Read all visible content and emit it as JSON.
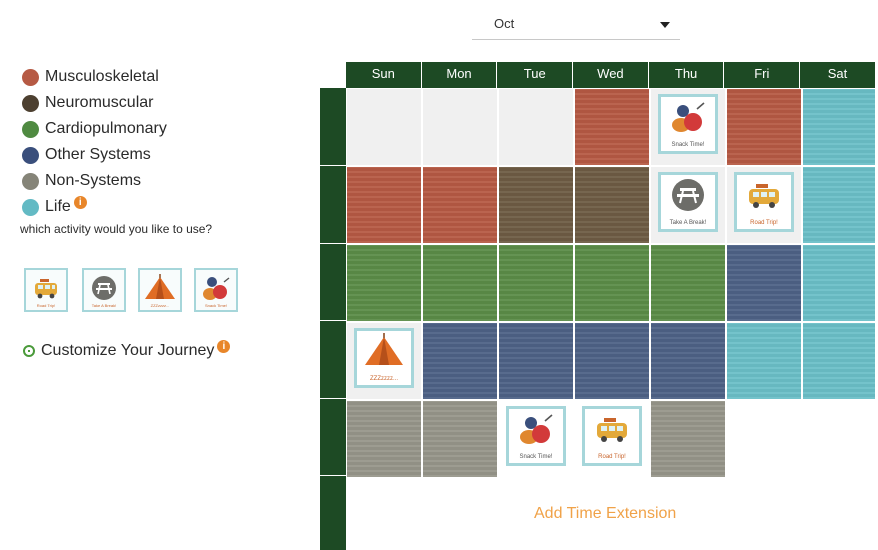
{
  "month_select": {
    "value": "Oct"
  },
  "legend": [
    {
      "label": "Musculoskeletal",
      "color": "#b65a44"
    },
    {
      "label": "Neuromuscular",
      "color": "#4d4030"
    },
    {
      "label": "Cardiopulmonary",
      "color": "#4f8a41"
    },
    {
      "label": "Other Systems",
      "color": "#3a4f7c"
    },
    {
      "label": "Non-Systems",
      "color": "#858478"
    },
    {
      "label": "Life",
      "color": "#63bac4"
    }
  ],
  "info_badge": "i",
  "question": "which activity would you like to use?",
  "activities": [
    {
      "icon": "road-trip-icon",
      "label": "Road Trip!"
    },
    {
      "icon": "take-a-break-icon",
      "label": "Take A Break!"
    },
    {
      "icon": "tent-icon",
      "label": "ZZZzzzz..."
    },
    {
      "icon": "snack-time-icon",
      "label": "Snack Time!"
    }
  ],
  "customize": "Customize Your Journey",
  "calendar": {
    "days": [
      "Sun",
      "Mon",
      "Tue",
      "Wed",
      "Thu",
      "Fri",
      "Sat"
    ],
    "placed_activities": {
      "snack": "Snack Time!",
      "break": "Take A Break!",
      "road": "Road Trip!",
      "tent": "ZZZzzzz..."
    }
  },
  "add_time_extension": "Add Time Extension"
}
